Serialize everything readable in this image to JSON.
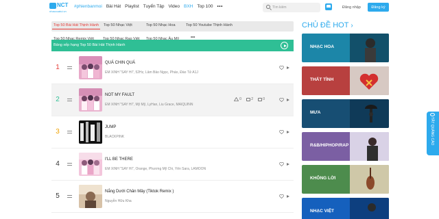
{
  "header": {
    "logo_text": "NCT",
    "logo_sub": "nhaccuatui.vn",
    "nav": [
      "#phienbanmoi",
      "Bài Hát",
      "Playlist",
      "Tuyển Tập",
      "Video",
      "BXH",
      "Top 100",
      "•••"
    ],
    "search_placeholder": "Tìm kiếm",
    "login": "Đăng nhập",
    "signup": "Đăng ký"
  },
  "tabs": {
    "row1": [
      "Top 50 Bài Hát Thịnh Hành",
      "Top 50 Nhạc Việt",
      "Top 50 Nhạc Hoa",
      "Top 50 Youtube Thịnh Hành"
    ],
    "row2": [
      "Top 50 Nhạc Remix Việt",
      "Top 50 Nhạc Rap Việt",
      "Top 50 Nhạc Âu Mỹ"
    ],
    "more": "•••",
    "active": "Top 50 Bài Hát Thịnh Hành"
  },
  "banner": {
    "text": "Bảng xếp hạng Top 50 Bài Hát Thịnh Hành"
  },
  "songs": [
    {
      "rank": "1",
      "title": "QUÁ CHIN QUÁ",
      "artist": "EM XINH \"SAY HI\", 52Hz, Lâm Bảo Ngọc, Pháo, Đào Tử A1J",
      "rank_color": "#e53935",
      "stats": null
    },
    {
      "rank": "2",
      "title": "NOT MY FAULT",
      "artist": "EM XINH \"SAY HI\", Mỹ Mỹ, LyHan, Liu Grace, MAIQUINN",
      "rank_color": "#2fbf95",
      "stats": {
        "likes": "0",
        "comments": "2",
        "shares": "0"
      }
    },
    {
      "rank": "3",
      "title": "JUMP",
      "artist": "BLACKPINK",
      "rank_color": "#f0a202",
      "stats": null
    },
    {
      "rank": "4",
      "title": "I'LL BE THERE",
      "artist": "EM XINH \"SAY HI\", Orange, Phương Mỹ Chi, Yên Sara, LAMOON",
      "rank_color": "#333333",
      "stats": null
    },
    {
      "rank": "5",
      "title": "Nắng Dưới Chân Mây (Tiktok Remix )",
      "artist": "Nguyễn Hữu Kha",
      "rank_color": "#333333",
      "stats": null
    }
  ],
  "hot_topics": {
    "title": "CHỦ ĐỀ HOT",
    "chevron": "›",
    "items": [
      {
        "label": "NHẠC HOA",
        "color": "#1f8fb0"
      },
      {
        "label": "THẤT TÌNH",
        "color": "#b53a3a"
      },
      {
        "label": "MƯA",
        "color": "#1a5f8a"
      },
      {
        "label": "R&B/HIPHOP/RAP",
        "color": "#7a5fa0"
      },
      {
        "label": "KHÔNG LỜI",
        "color": "#4f8a4f"
      },
      {
        "label": "NHẠC VIỆT",
        "color": "#1565c0"
      }
    ]
  },
  "side_tab": {
    "text": "TẮT QUẢNG CÁO"
  }
}
